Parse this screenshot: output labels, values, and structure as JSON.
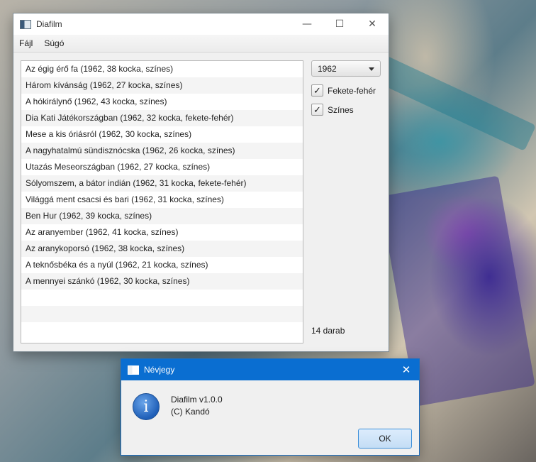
{
  "main_window": {
    "title": "Diafilm",
    "controls": {
      "minimize": "—",
      "maximize": "☐",
      "close": "✕"
    },
    "menu": [
      "Fájl",
      "Súgó"
    ],
    "list_items": [
      "Az égig érő fa (1962, 38 kocka, színes)",
      "Három kívánság (1962, 27 kocka, színes)",
      "A hókirálynő (1962, 43 kocka, színes)",
      "Dia Kati Játékországban (1962, 32 kocka, fekete-fehér)",
      "Mese a kis óriásról (1962, 30 kocka, színes)",
      "A nagyhatalmú sündisznócska (1962, 26 kocka, színes)",
      "Utazás Meseországban (1962, 27 kocka, színes)",
      "Sólyomszem, a bátor indián (1962, 31 kocka, fekete-fehér)",
      "Világgá ment csacsi és bari (1962, 31 kocka, színes)",
      "Ben Hur (1962, 39 kocka, színes)",
      "Az aranyember (1962, 41 kocka, színes)",
      "Az aranykoporsó (1962, 38 kocka, színes)",
      "A teknősbéka és a nyúl (1962, 21 kocka, színes)",
      "A mennyei szánkó (1962, 30 kocka, színes)"
    ],
    "year_select": {
      "value": "1962"
    },
    "checkboxes": [
      {
        "label": "Fekete-fehér",
        "checked": true
      },
      {
        "label": "Színes",
        "checked": true
      }
    ],
    "count_label": "14 darab"
  },
  "about_dialog": {
    "title": "Névjegy",
    "close": "✕",
    "icon": "info-icon",
    "line1": "Diafilm v1.0.0",
    "line2": "(C) Kandó",
    "ok_label": "OK"
  },
  "colors": {
    "dialog_titlebar": "#0a6ed1",
    "ok_button": "#c4ddf5",
    "window_bg": "#f0f0f0"
  }
}
